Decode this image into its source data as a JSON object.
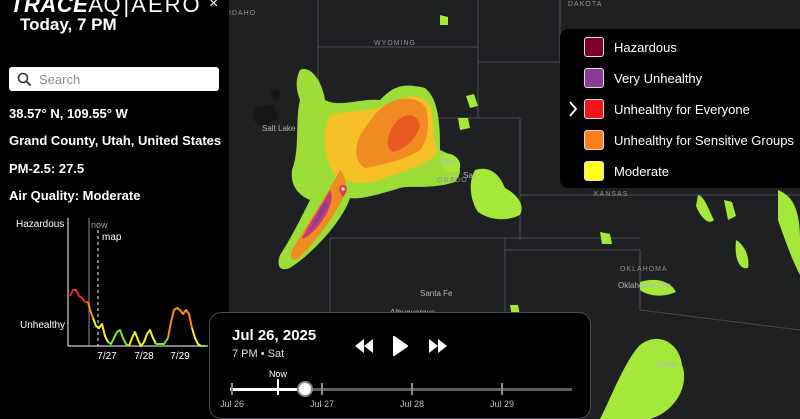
{
  "brand": {
    "part1": "TRACE",
    "part2": "AQ",
    "part3": "AERO"
  },
  "close_glyph": "×",
  "sidebar": {
    "time_title": "Today, 7 PM",
    "search_placeholder": "Search",
    "coordinates": "38.57° N, 109.55° W",
    "location": "Grand County, Utah, United States",
    "pm25": "PM-2.5: 27.5",
    "air_quality": "Air Quality: Moderate"
  },
  "mini_chart": {
    "type": "line",
    "y_labels": {
      "top": "Hazardous",
      "bottom": "Unhealthy"
    },
    "markers": {
      "now": "now",
      "map": "map"
    },
    "x_ticks": [
      "7/27",
      "7/28",
      "7/29"
    ],
    "colors": {
      "unhealthy": "#e8262a",
      "sensitive": "#ff8a1e",
      "moderate": "#f2f21b",
      "good": "#7fe32b"
    }
  },
  "legend": {
    "items": [
      {
        "label": "Hazardous",
        "color": "#7a0027"
      },
      {
        "label": "Very Unhealthy",
        "color": "#8b3c96"
      },
      {
        "label": "Unhealthy for Everyone",
        "color": "#f2141a"
      },
      {
        "label": "Unhealthy for Sensitive Groups",
        "color": "#ff7e17"
      },
      {
        "label": "Moderate",
        "color": "#ffff1b"
      }
    ]
  },
  "timeline": {
    "date": "Jul 26, 2025",
    "subtitle": "7 PM • Sat",
    "now_label": "Now",
    "tick_labels": [
      "Jul 26",
      "Jul 27",
      "Jul 28",
      "Jul 29"
    ],
    "position_fraction": 0.22
  },
  "map_labels": {
    "states": [
      "IDAHO",
      "WYOMING",
      "DAKOTA",
      "KANSAS",
      "OKLAHOMA",
      "ORADO"
    ],
    "cities": [
      "Salt Lake",
      "Den",
      "Santa Fe",
      "Albuquerque",
      "Oklahoma City",
      "Dallas",
      "Sat"
    ]
  }
}
